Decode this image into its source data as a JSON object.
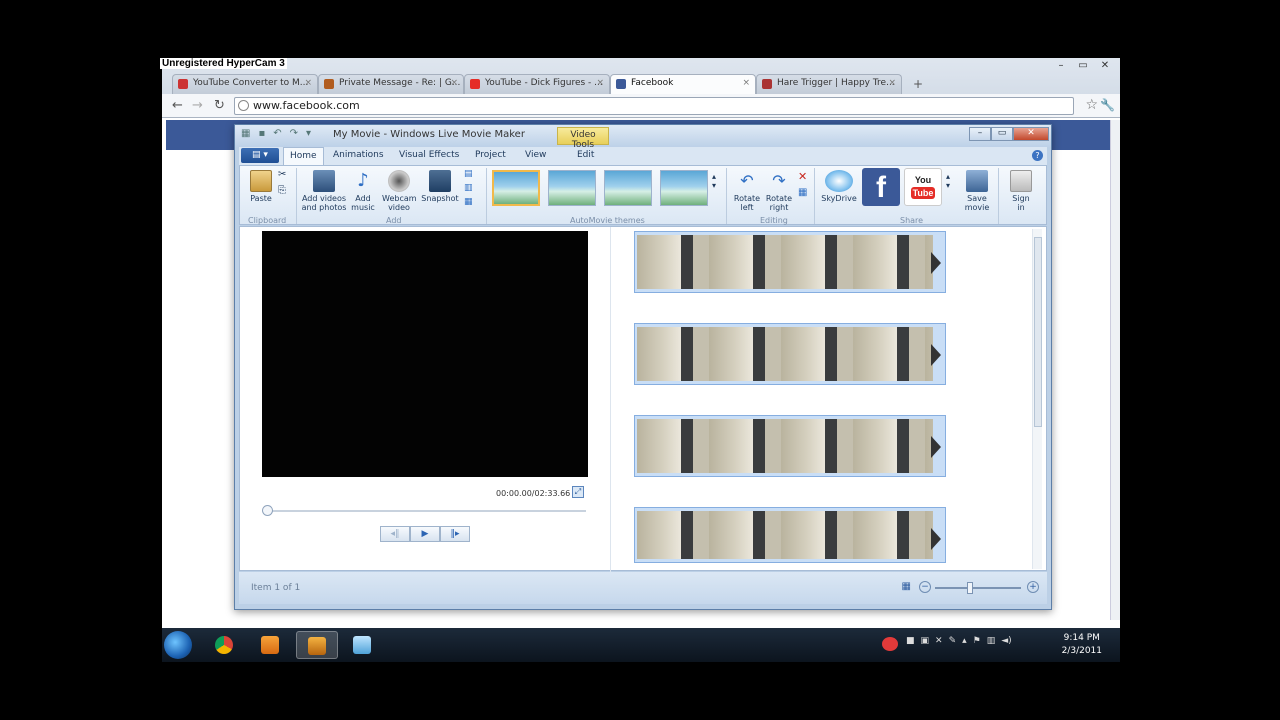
{
  "overlay": {
    "watermark": "Unregistered HyperCam 3"
  },
  "browser": {
    "tabs": [
      {
        "label": "YouTube Converter to M...",
        "fav_color": "#c33"
      },
      {
        "label": "Private Message - Re: | G...",
        "fav_color": "#b15c1f"
      },
      {
        "label": "YouTube - Dick Figures - ...",
        "fav_color": "#e52d27"
      },
      {
        "label": "Facebook",
        "fav_color": "#3b5998"
      },
      {
        "label": "Hare Trigger | Happy Tre...",
        "fav_color": "#a33"
      }
    ],
    "address": "www.facebook.com"
  },
  "moviemaker": {
    "title": "My Movie - Windows Live Movie Maker",
    "context_tab": "Video Tools",
    "tabs": [
      "Home",
      "Animations",
      "Visual Effects",
      "Project",
      "View",
      "Edit"
    ],
    "clipboard": {
      "paste": "Paste",
      "group": "Clipboard"
    },
    "add": {
      "add_videos_1": "Add videos",
      "add_videos_2": "and photos",
      "add_music_1": "Add",
      "add_music_2": "music",
      "webcam_1": "Webcam",
      "webcam_2": "video",
      "snapshot": "Snapshot",
      "group": "Add"
    },
    "themes_group": "AutoMovie themes",
    "editing": {
      "rotate_left_1": "Rotate",
      "rotate_left_2": "left",
      "rotate_right_1": "Rotate",
      "rotate_right_2": "right",
      "group": "Editing"
    },
    "share": {
      "skydrive": "SkyDrive",
      "save_1": "Save",
      "save_2": "movie",
      "sign_1": "Sign",
      "sign_2": "in",
      "group": "Share"
    },
    "timecode": "00:00.00/02:33.66",
    "status": "Item 1 of 1"
  },
  "taskbar": {
    "time": "9:14 PM",
    "date": "2/3/2011"
  },
  "colors": {
    "facebook_blue": "#3b5998",
    "youtube_red": "#e52d27",
    "ribbon_accent": "#1e395b"
  }
}
